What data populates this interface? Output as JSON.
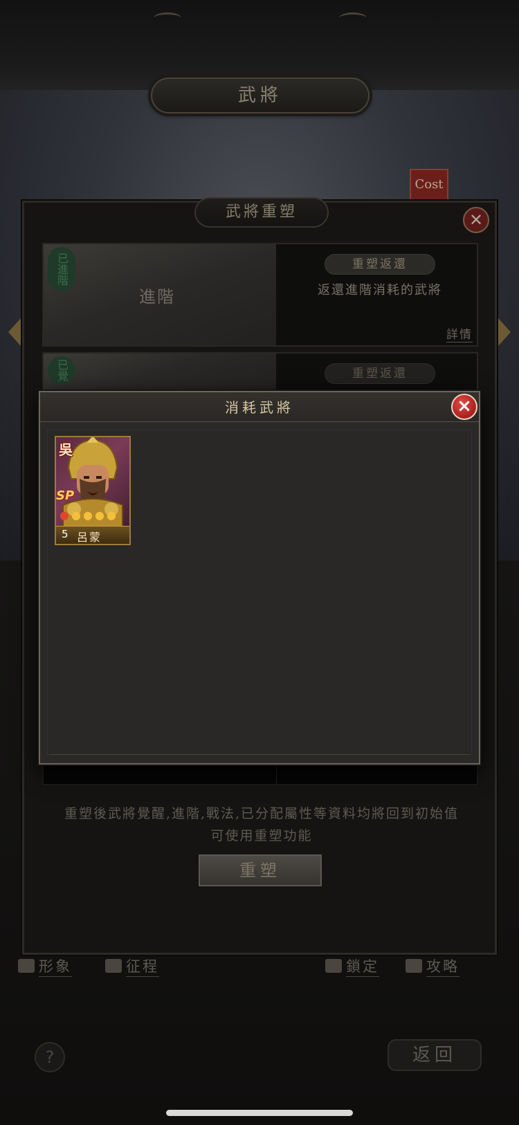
{
  "top": {
    "title": "武將",
    "cost_badge": "Cost"
  },
  "outer_panel": {
    "title": "武將重塑",
    "close_glyph": "✕",
    "section1": {
      "stamp": "已進階",
      "art_label": "進階",
      "pill": "重塑返還",
      "desc": "返還進階消耗的武將",
      "more": "詳情"
    },
    "section2": {
      "stamp": "已覺",
      "pill": "重塑返還"
    },
    "note_line1": "重塑後武將覺醒,進階,戰法,已分配屬性等資料均將回到初始值",
    "note_line2": "可使用重塑功能",
    "reforge_button": "重塑"
  },
  "bottom_nav": {
    "image": "形象",
    "expedition": "征程",
    "lock": "鎖定",
    "strategy": "攻略"
  },
  "help_glyph": "?",
  "back_button": "返回",
  "modal": {
    "title": "消耗武將",
    "close_glyph": "×",
    "general": {
      "faction": "吳",
      "sp": "SP",
      "cost": "5",
      "name": "呂蒙",
      "stars_total": 5
    }
  }
}
